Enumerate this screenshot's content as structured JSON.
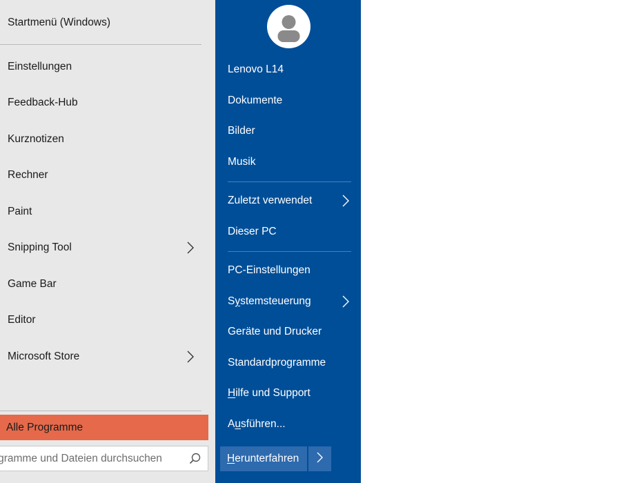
{
  "left_panel": {
    "items": [
      {
        "label": "Startmenü (Windows)",
        "has_submenu": false
      },
      {
        "label": "Einstellungen",
        "has_submenu": false
      },
      {
        "label": "Feedback-Hub",
        "has_submenu": false
      },
      {
        "label": "Kurznotizen",
        "has_submenu": false
      },
      {
        "label": "Rechner",
        "has_submenu": false
      },
      {
        "label": "Paint",
        "has_submenu": false
      },
      {
        "label": "Snipping Tool",
        "has_submenu": true
      },
      {
        "label": "Game Bar",
        "has_submenu": false
      },
      {
        "label": "Editor",
        "has_submenu": false
      },
      {
        "label": "Microsoft Store",
        "has_submenu": true
      }
    ],
    "all_programs_label": "Alle Programme",
    "search": {
      "placeholder": "Programme und Dateien durchsuchen",
      "icon": "search-icon"
    }
  },
  "right_panel": {
    "avatar_icon": "user-avatar-icon",
    "items": [
      {
        "label": "Lenovo L14",
        "has_submenu": false
      },
      {
        "label": "Dokumente",
        "has_submenu": false
      },
      {
        "label": "Bilder",
        "has_submenu": false
      },
      {
        "label": "Musik",
        "has_submenu": false
      },
      {
        "label": "Zuletzt verwendet",
        "has_submenu": true
      },
      {
        "label": "Dieser PC",
        "has_submenu": false
      },
      {
        "label_pre": "PC-Einstellungen",
        "label_u": "",
        "label_post": "",
        "has_submenu": false
      },
      {
        "label_pre": "S",
        "label_u": "y",
        "label_post": "stemsteuerung",
        "has_submenu": true
      },
      {
        "label": "Geräte und Drucker",
        "has_submenu": false
      },
      {
        "label": "Standardprogramme",
        "has_submenu": false
      },
      {
        "label_pre": "",
        "label_u": "H",
        "label_post": "ilfe und Support",
        "has_submenu": false
      },
      {
        "label_pre": "A",
        "label_u": "u",
        "label_post": "sführen...",
        "has_submenu": false
      }
    ],
    "shutdown": {
      "label_u": "H",
      "label_post": "erunterfahren",
      "arrow_icon": "chevron-right-icon"
    }
  },
  "colors": {
    "left_background": "#e8e8e8",
    "right_background": "#004e98",
    "highlight": "#e5694a",
    "shutdown_button": "#2e6aae"
  }
}
